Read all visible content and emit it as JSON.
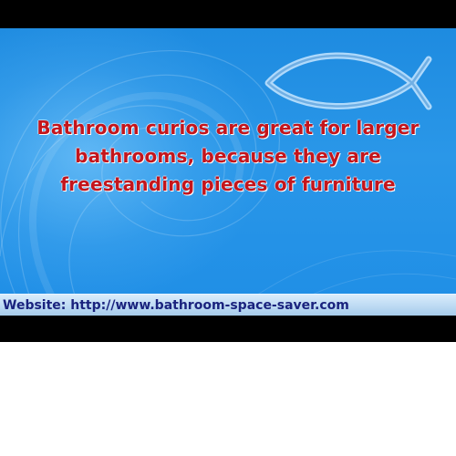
{
  "slide": {
    "headline_lines": [
      "Bathroom curios are great for larger",
      "bathrooms, because they are",
      "freestanding pieces of furniture"
    ]
  },
  "website_bar": {
    "text": "Website: http://www.bathroom-space-saver.com"
  },
  "icons": {
    "logo": "ichthys-fish-icon"
  },
  "colors": {
    "background_blue": "#1f8ee6",
    "headline_red": "#c4151c",
    "website_text": "#1a237e",
    "letterbox": "#000000"
  }
}
